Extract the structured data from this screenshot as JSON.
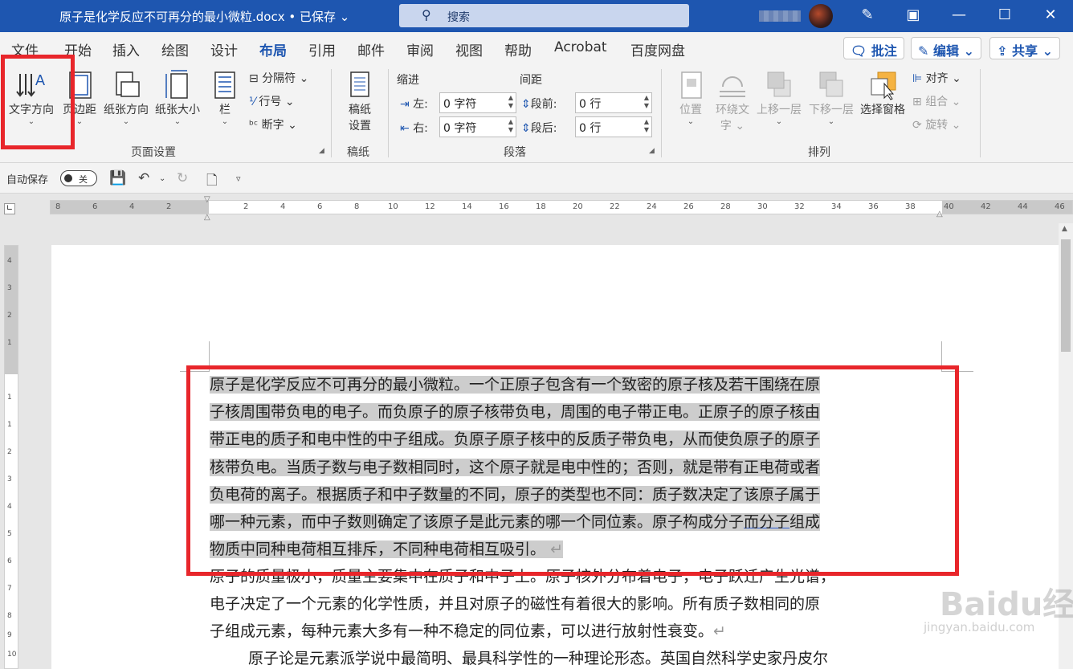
{
  "titlebar": {
    "doc_title": "原子是化学反应不可再分的最小微粒.docx • 已保存",
    "search_placeholder": "搜索"
  },
  "tabs": [
    "文件",
    "开始",
    "插入",
    "绘图",
    "设计",
    "布局",
    "引用",
    "邮件",
    "审阅",
    "视图",
    "帮助",
    "Acrobat",
    "百度网盘"
  ],
  "active_tab": "布局",
  "actions": {
    "comment": "批注",
    "edit": "编辑",
    "share": "共享"
  },
  "ribbon": {
    "page_setup": {
      "text_direction": "文字方向",
      "margins": "页边距",
      "orientation": "纸张方向",
      "size": "纸张大小",
      "columns": "栏",
      "breaks": "分隔符",
      "line_numbers": "行号",
      "hyphenation": "断字",
      "label": "页面设置"
    },
    "manuscript": {
      "settings_line1": "稿纸",
      "settings_line2": "设置",
      "label": "稿纸"
    },
    "paragraph": {
      "indent_title": "缩进",
      "spacing_title": "间距",
      "left_label": "左:",
      "right_label": "右:",
      "before_label": "段前:",
      "after_label": "段后:",
      "left_value": "0 字符",
      "right_value": "0 字符",
      "before_value": "0 行",
      "after_value": "0 行",
      "label": "段落"
    },
    "arrange": {
      "position": "位置",
      "wrap_line1": "环绕文",
      "wrap_line2": "字",
      "bring_forward": "上移一层",
      "send_backward": "下移一层",
      "selection_pane": "选择窗格",
      "align": "对齐",
      "group": "组合",
      "rotate": "旋转",
      "label": "排列"
    }
  },
  "qat": {
    "autosave": "自动保存",
    "toggle_state": "关"
  },
  "ruler": {
    "ticks": [
      "8",
      "6",
      "4",
      "2",
      "2",
      "4",
      "6",
      "8",
      "10",
      "12",
      "14",
      "16",
      "18",
      "20",
      "22",
      "24",
      "26",
      "28",
      "30",
      "32",
      "34",
      "36",
      "38",
      "40",
      "42",
      "44",
      "46"
    ],
    "vticks": [
      "4",
      "3",
      "2",
      "1",
      "1",
      "1",
      "2",
      "3",
      "4",
      "5",
      "6",
      "7",
      "8",
      "9",
      "10"
    ]
  },
  "document": {
    "selected_lines": [
      "原子是化学反应不可再分的最小微粒。一个正原子包含有一个致密的原子核及若干围绕在原",
      "子核周围带负电的电子。而负原子的原子核带负电，周围的电子带正电。正原子的原子核由",
      "带正电的质子和电中性的中子组成。负原子原子核中的反质子带负电，从而使负原子的原子",
      "核带负电。当质子数与电子数相同时，这个原子就是电中性的；否则，就是带有正电荷或者",
      "负电荷的离子。根据质子和中子数量的不同，原子的类型也不同：质子数决定了该原子属于",
      "哪一种元素，而中子数则确定了该原子是此元素的哪一个同位素。原子构成分子"
    ],
    "line6_underlined": "而分子",
    "line6_tail": "组成",
    "line7": "物质中同种电荷相互排斥，不同种电荷相互吸引。",
    "paragraph_mark": "↵",
    "para2_lines": [
      "原子的质量极小，质量主要集中在质子和中子上。原子核外分布着电子，电子跃迁产生光谱，",
      "电子决定了一个元素的化学性质，并且对原子的磁性有着很大的影响。所有质子数相同的原",
      "子组成元素，每种元素大多有一种不稳定的同位素，可以进行放射性衰变。"
    ],
    "para3_line": "原子论是元素派学说中最简明、最具科学性的一种理论形态。英国自然科学史家丹皮尔"
  },
  "watermark": {
    "brand": "Baidu经验",
    "url": "jingyan.baidu.com"
  },
  "colors": {
    "titlebar": "#1e56b0",
    "accent": "#1e56b0",
    "annotation": "#e8262b",
    "selection": "#cdcdcd"
  }
}
